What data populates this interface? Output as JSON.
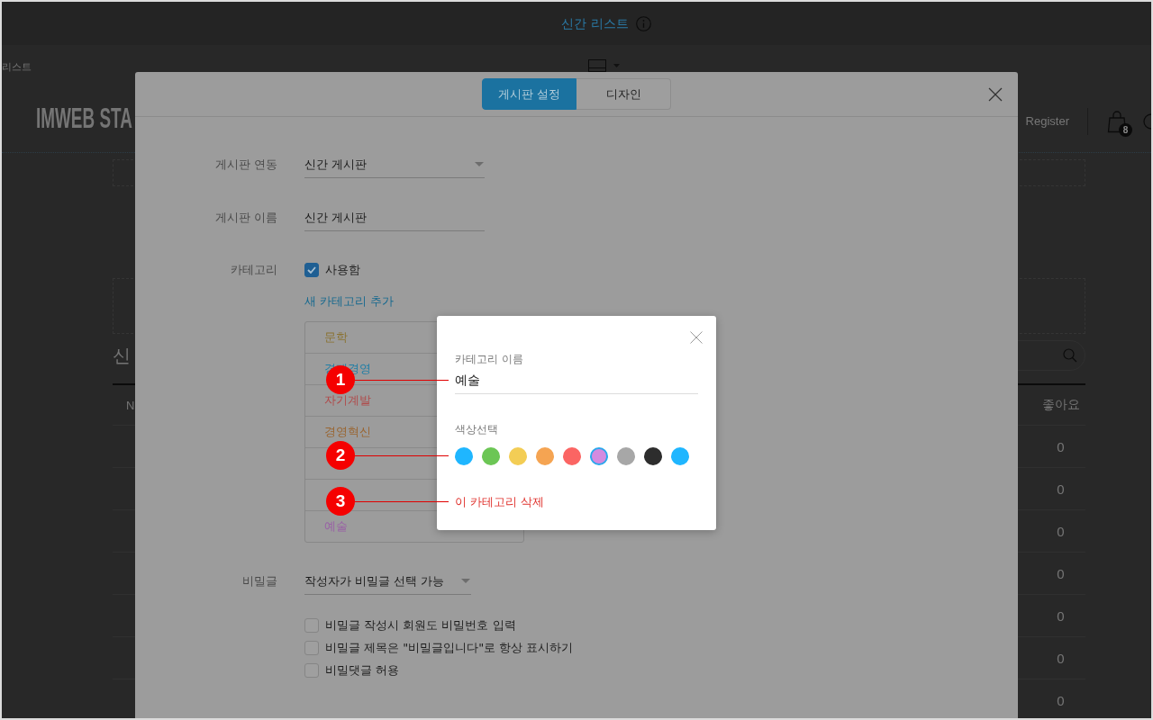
{
  "background_page": {
    "top_bar": {
      "title": "신간 리스트"
    },
    "sub_bar": {
      "breadcrumb": "리스트"
    },
    "header": {
      "logo": "IMWEB STA",
      "register_link": "Register",
      "cart_badge": "8"
    },
    "board": {
      "heading": "신",
      "table": {
        "columns": [
          "N",
          "좋아요"
        ],
        "rows": [
          {
            "likes": "0"
          },
          {
            "likes": "0"
          },
          {
            "likes": "0"
          },
          {
            "likes": "0"
          },
          {
            "likes": "0"
          },
          {
            "likes": "0"
          },
          {
            "likes": "0"
          }
        ]
      }
    }
  },
  "settings_modal": {
    "tabs": [
      {
        "label": "게시판 설정",
        "selected": true
      },
      {
        "label": "디자인",
        "selected": false
      }
    ],
    "board_link": {
      "label": "게시판 연동",
      "value": "신간 게시판"
    },
    "board_name": {
      "label": "게시판 이름",
      "value": "신간 게시판"
    },
    "category": {
      "label": "카테고리",
      "checkbox": {
        "label": "사용함",
        "checked": true
      },
      "add_link": "새 카테고리 추가",
      "items": [
        {
          "kind": "category",
          "label": "문학",
          "color": "#8a7230"
        },
        {
          "kind": "category",
          "label": "경제경영",
          "color": "#1f7ea6"
        },
        {
          "kind": "category",
          "label": "자기계발",
          "color": "#b04a4a"
        },
        {
          "kind": "category",
          "label": "경영혁신",
          "color": "#9a6530"
        },
        {
          "kind": "covered"
        },
        {
          "kind": "covered"
        },
        {
          "kind": "category",
          "label": "예술",
          "color": "#9960a6"
        }
      ]
    },
    "secret_post": {
      "label": "비밀글",
      "value": "작성자가 비밀글 선택 가능",
      "options": [
        {
          "label": "비밀글 작성시 회원도 비밀번호 입력",
          "checked": false
        },
        {
          "label": "비밀글 제목은 \"비밀글입니다\"로 항상 표시하기",
          "checked": false
        },
        {
          "label": "비밀댓글 허용",
          "checked": false
        }
      ]
    }
  },
  "category_popup": {
    "name_label": "카테고리 이름",
    "name_value": "예술",
    "color_label": "색상선택",
    "swatches": [
      {
        "color": "#1fb6ff",
        "selected": false
      },
      {
        "color": "#6cc655",
        "selected": false
      },
      {
        "color": "#f3cd55",
        "selected": false
      },
      {
        "color": "#f5a452",
        "selected": false
      },
      {
        "color": "#fb6563",
        "selected": false
      },
      {
        "color": "#d38be0",
        "selected": true
      },
      {
        "color": "#a7a7a7",
        "selected": false
      },
      {
        "color": "#2d2d2d",
        "selected": false
      },
      {
        "color": "#1fb6ff",
        "selected": false
      }
    ],
    "delete_link": "이 카테고리 삭제"
  },
  "annotations": [
    {
      "number": "1"
    },
    {
      "number": "2"
    },
    {
      "number": "3"
    }
  ]
}
